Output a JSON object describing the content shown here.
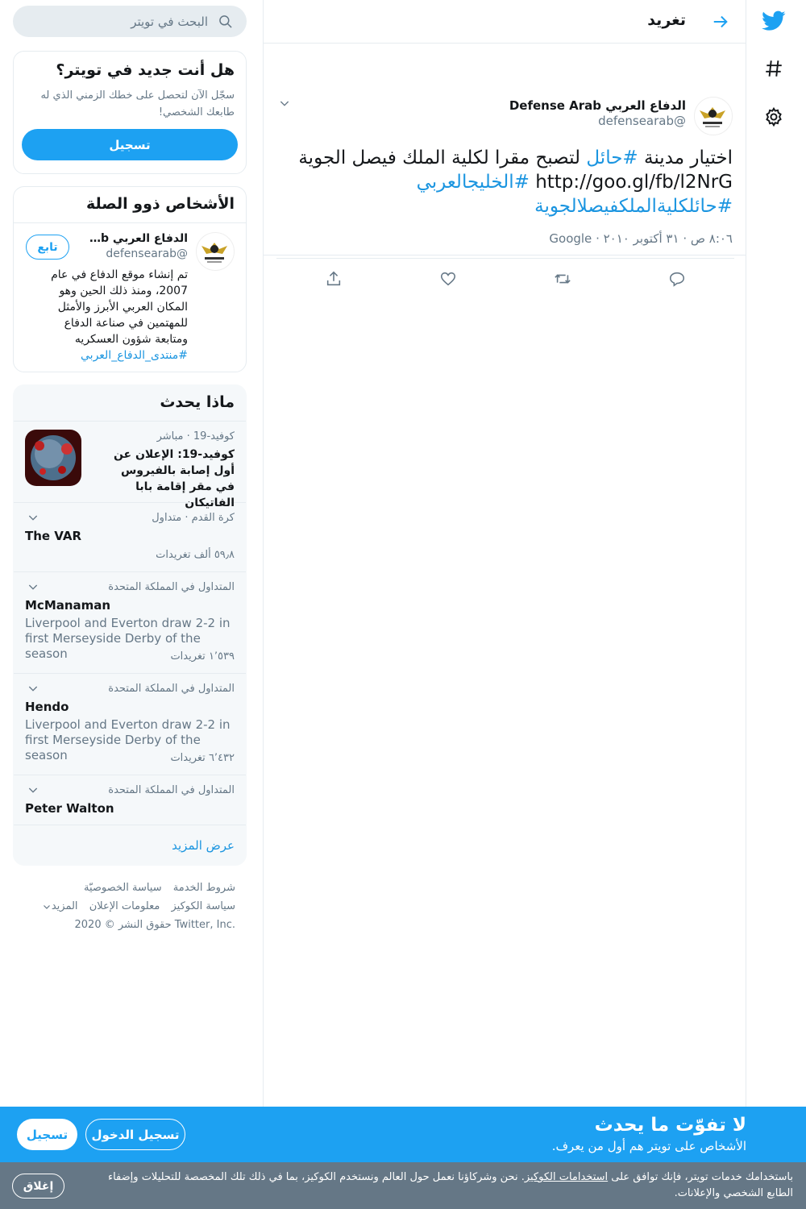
{
  "colors": {
    "accent": "#1da1f2",
    "link": "#1b95e0",
    "muted": "#657786",
    "banner_bg": "#1da1f2",
    "cookie_bg": "#657786"
  },
  "nav": {
    "icons": [
      "twitter-logo-icon",
      "hashtag-icon",
      "gear-icon"
    ]
  },
  "header": {
    "title": "تغريد"
  },
  "tweet": {
    "name": "الدفاع العربي Defense Arab",
    "handle": "@defensearab",
    "text_plain_1": "اختيار مدينة",
    "hashtag_1": "#حائل",
    "text_plain_2": "لتصبح مقرا لكلية الملك فيصل الجوية",
    "url": "http://goo.gl/fb/l2NrG",
    "hashtag_2": "#الخليجالعربي",
    "hashtag_3": "#حائلكليةالملكفيصلالجوية",
    "meta": "٨:٠٦ ص · ٣١ أكتوبر ٢٠١٠ · Google",
    "actions": [
      "reply-icon",
      "retweet-icon",
      "like-icon",
      "share-icon"
    ]
  },
  "search": {
    "placeholder": "البحث في تويتر"
  },
  "join": {
    "title": "هل أنت جديد في تويتر؟",
    "desc": "سجّل الآن لتحصل على خطك الزمني الذي له طابعك الشخصي!",
    "button": "تسجيل"
  },
  "related": {
    "title": "الأشخاص ذوو الصلة",
    "name": "الدفاع العربي Defense Arab",
    "handle": "@defensearab",
    "follow": "تابع",
    "bio": "تم إنشاء موقع الدفاع في عام 2007، ومنذ ذلك الحين وهو المكان العربي الأبرز والأمثل للمهتمين في صناعة الدفاع ومتابعة شؤون العسكريه",
    "bio_hashtag": "#منتدى_الدفاع_العربي"
  },
  "trends": {
    "title": "ماذا يحدث",
    "items": [
      {
        "meta": "كوفيد-19 · مباشر",
        "name": "كوفيد-19: الإعلان عن أول إصابة بالفيروس في مقر إقامة بابا الفاتيكان"
      },
      {
        "meta": "كرة القدم · متداول",
        "name": "The VAR",
        "count": "٥٩٫٨ ألف تغريدات"
      },
      {
        "meta": "المتداول في المملكة المتحدة",
        "name": "McManaman",
        "desc": "Liverpool and Everton draw 2-2 in first Merseyside Derby of the season",
        "count": "١٬٥٣٩ تغريدات"
      },
      {
        "meta": "المتداول في المملكة المتحدة",
        "name": "Hendo",
        "desc": "Liverpool and Everton draw 2-2 in first Merseyside Derby of the season",
        "count": "٦٬٤٣٢ تغريدات"
      },
      {
        "meta": "المتداول في المملكة المتحدة",
        "name": "Peter Walton"
      }
    ],
    "show_more": "عرض المزيد"
  },
  "footer": {
    "terms": "شروط الخدمة",
    "privacy": "سياسة الخصوصيّة",
    "cookies": "سياسة الكوكيز",
    "ads": "معلومات الإعلان",
    "more": "المزيد",
    "copyright": "حقوق النشر © 2020 Twitter, Inc."
  },
  "banner": {
    "title": "لا تفوّت ما يحدث",
    "subtitle": "الأشخاص على تويتر هم أول من يعرف.",
    "login": "تسجيل الدخول",
    "signup": "تسجيل"
  },
  "cookie": {
    "text_1": "باستخدامك خدمات تويتر، فإنك توافق على",
    "link": "استخدامات الكوكيز",
    "text_2": ". نحن وشركاؤنا نعمل حول العالم ونستخدم الكوكيز، بما في ذلك تلك المخصصة للتحليلات وإضفاء الطابع الشخصي والإعلانات.",
    "close": "إغلاق"
  }
}
